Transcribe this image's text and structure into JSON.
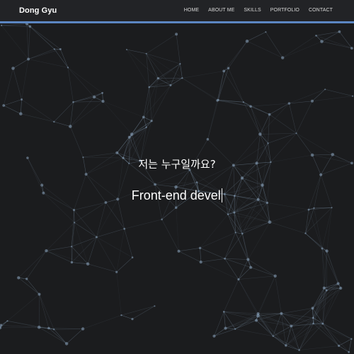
{
  "navbar": {
    "brand": "Dong Gyu",
    "links": [
      "HOME",
      "ABOUT ME",
      "SKILLS",
      "PORTFOLIO",
      "CONTACT"
    ]
  },
  "hero": {
    "question": "저는 누구일까요?",
    "typed_text": "Front-end devel"
  },
  "colors": {
    "background": "#1b1c1e",
    "navbar": "#222326",
    "accent": "#5b86c2",
    "network": "#8ca6bf"
  }
}
